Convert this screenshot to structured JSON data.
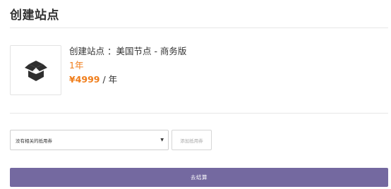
{
  "page": {
    "title": "创建站点"
  },
  "product": {
    "icon": "box-icon",
    "name": "创建站点 ：美国节点 - 商务版",
    "term": "1年",
    "price_amount": "¥4999",
    "price_unit": " / 年"
  },
  "coupon": {
    "selected": "没有相关的抵用券",
    "add_label": "添加抵用券"
  },
  "checkout": {
    "label": "去结算"
  },
  "colors": {
    "accent_orange": "#f07d1a",
    "button_purple": "#7469a0",
    "icon_dark": "#2f2f2f"
  }
}
